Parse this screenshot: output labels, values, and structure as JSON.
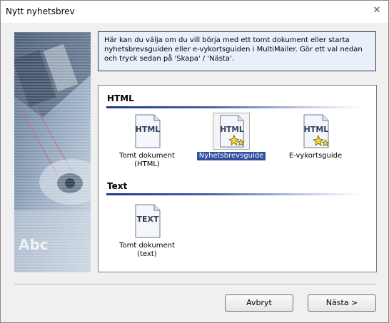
{
  "window": {
    "title": "Nytt nyhetsbrev"
  },
  "info": {
    "text": "Här kan du välja om du vill börja med ett tomt dokument eller starta nyhetsbrevsguiden eller e-vykortsguiden i MultiMailer. Gör ett val nedan och tryck sedan på 'Skapa' / 'Nästa'."
  },
  "sections": [
    {
      "title": "HTML",
      "items": [
        {
          "label": "Tomt dokument (HTML)",
          "icon": "html-document-icon",
          "selected": false
        },
        {
          "label": "Nyhetsbrevsguide",
          "icon": "html-wizard-icon",
          "selected": true
        },
        {
          "label": "E-vykortsguide",
          "icon": "html-wizard-icon",
          "selected": false
        }
      ]
    },
    {
      "title": "Text",
      "items": [
        {
          "label": "Tomt dokument (text)",
          "icon": "text-document-icon",
          "selected": false
        }
      ]
    }
  ],
  "icon_text": {
    "html": "HTML",
    "text": "TEXT"
  },
  "side_image_text": "Abc",
  "buttons": {
    "cancel": "Avbryt",
    "next": "Nästa >"
  },
  "colors": {
    "selection": "#2f4f9f",
    "info_bg": "#e8f1fb",
    "section_bar": "#1e3a8a"
  }
}
